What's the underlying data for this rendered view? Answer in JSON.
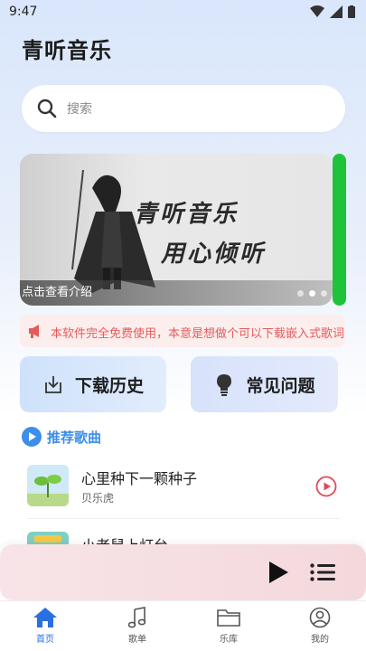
{
  "status": {
    "time": "9:47"
  },
  "app": {
    "title": "青听音乐"
  },
  "search": {
    "placeholder": "搜索"
  },
  "banner": {
    "line1": "青听音乐",
    "line2": "用心倾听",
    "caption": "点击查看介绍",
    "slide_count": 3,
    "active_slide": 2
  },
  "notice": {
    "text": "本软件完全免费使用，本意是想做个可以下载嵌入式歌词的播放器"
  },
  "actions": {
    "history_label": "下载历史",
    "faq_label": "常见问题"
  },
  "section": {
    "recommended_title": "推荐歌曲"
  },
  "songs": [
    {
      "title": "心里种下一颗种子",
      "artist": "贝乐虎"
    },
    {
      "title": "小老鼠上灯台",
      "artist": ""
    }
  ],
  "tabs": [
    {
      "label": "首页",
      "icon": "home-icon",
      "active": true
    },
    {
      "label": "歌单",
      "icon": "music-note-icon",
      "active": false
    },
    {
      "label": "乐库",
      "icon": "folder-icon",
      "active": false
    },
    {
      "label": "我的",
      "icon": "user-icon",
      "active": false
    }
  ],
  "colors": {
    "accent": "#2a6fe0",
    "section_title": "#3d8ee8",
    "notice_text": "#e65a5a",
    "play_button": "#e04a55",
    "banner_next_slide": "#1fc33a"
  }
}
